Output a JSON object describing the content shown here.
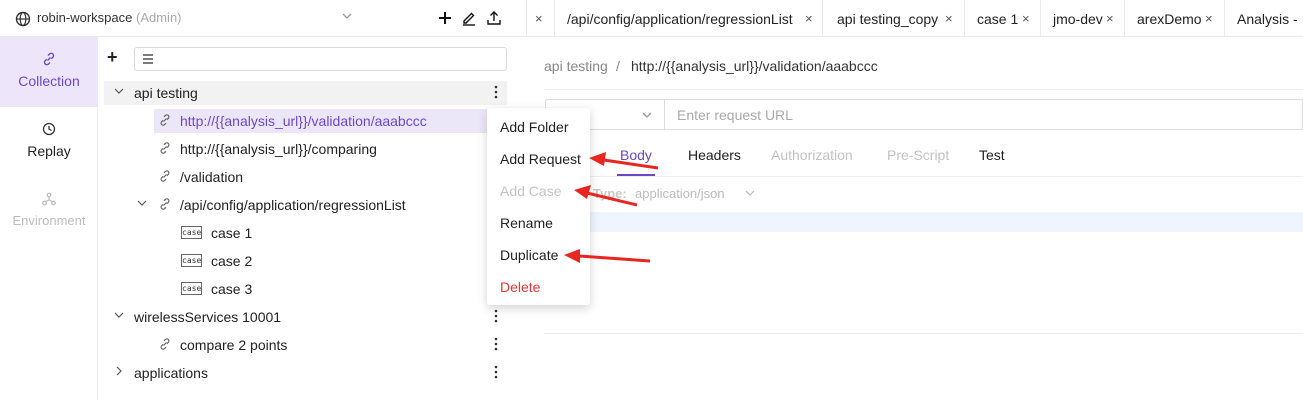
{
  "workspace": {
    "name": "robin-workspace",
    "role": "(Admin)"
  },
  "leftnav": [
    {
      "label": "Collection",
      "icon": "link-icon"
    },
    {
      "label": "Replay",
      "icon": "replay-icon"
    },
    {
      "label": "Environment",
      "icon": "environment-icon"
    }
  ],
  "tree": {
    "rows": [
      {
        "label": "api testing"
      },
      {
        "label": "http://{{analysis_url}}/validation/aaabccc"
      },
      {
        "label": "http://{{analysis_url}}/comparing"
      },
      {
        "label": "/validation"
      },
      {
        "label": "/api/config/application/regressionList"
      },
      {
        "label": "case 1",
        "badge": "case"
      },
      {
        "label": "case 2",
        "badge": "case"
      },
      {
        "label": "case 3",
        "badge": "case"
      },
      {
        "label": "wirelessServices 10001"
      },
      {
        "label": "compare 2 points"
      },
      {
        "label": "applications"
      }
    ]
  },
  "tabs": [
    {
      "label": "/api/config/application/regressionList"
    },
    {
      "label": "api testing_copy"
    },
    {
      "label": "case 1"
    },
    {
      "label": "jmo-dev"
    },
    {
      "label": "arexDemo"
    },
    {
      "label": "Analysis -"
    }
  ],
  "tab_close": "×",
  "breadcrumb": {
    "parent": "api testing",
    "sep": "/",
    "current": "http://{{analysis_url}}/validation/aaabccc"
  },
  "request": {
    "url_placeholder": "Enter request URL"
  },
  "subtabs": [
    {
      "label": "Body",
      "state": "active"
    },
    {
      "label": "Headers",
      "state": "normal"
    },
    {
      "label": "Authorization",
      "state": "disabled"
    },
    {
      "label": "Pre-Script",
      "state": "disabled"
    },
    {
      "label": "Test",
      "state": "normal"
    }
  ],
  "content_type": {
    "label": "Type:",
    "value": "application/json"
  },
  "context_menu": [
    {
      "label": "Add Folder",
      "state": "normal"
    },
    {
      "label": "Add Request",
      "state": "normal"
    },
    {
      "label": "Add Case",
      "state": "disabled"
    },
    {
      "label": "Rename",
      "state": "normal"
    },
    {
      "label": "Duplicate",
      "state": "normal"
    },
    {
      "label": "Delete",
      "state": "danger"
    }
  ],
  "colors": {
    "accent": "#6c48c7",
    "selected_bg": "#ece6f9",
    "danger": "#e53935",
    "arrow": "#e8261f"
  }
}
